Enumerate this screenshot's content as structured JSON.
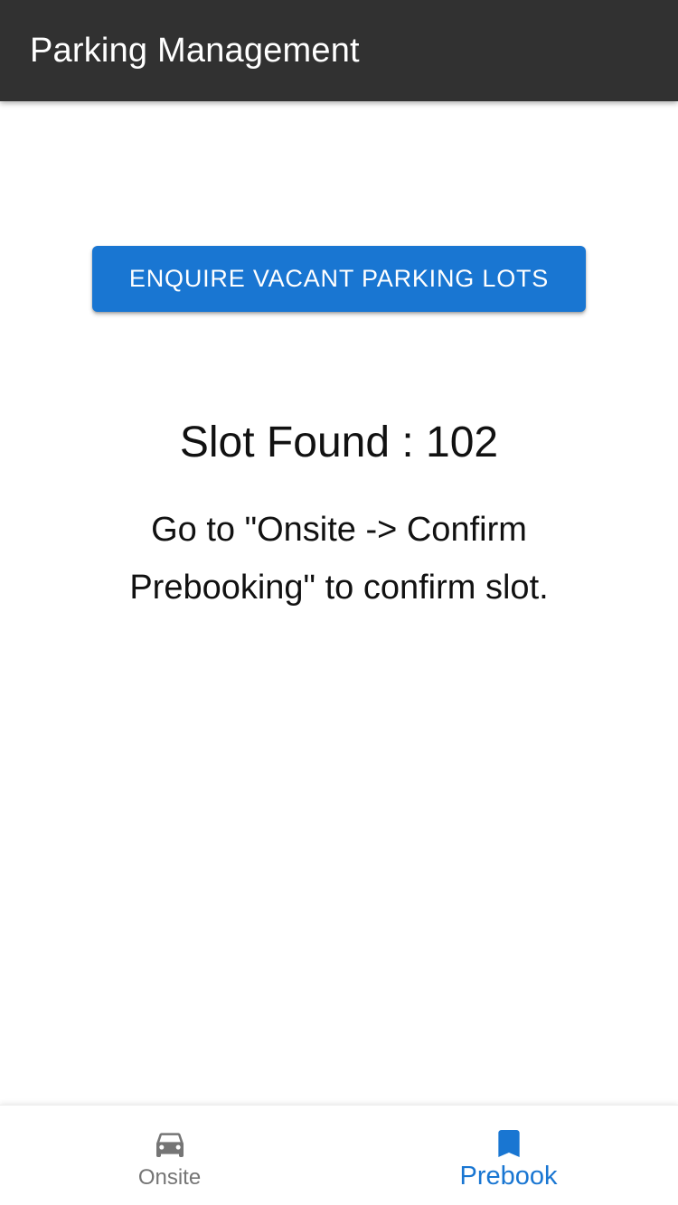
{
  "header": {
    "title": "Parking Management"
  },
  "main": {
    "enquire_button_label": "Enquire vacant parking lots",
    "slot_found_text": "Slot Found : 102",
    "instruction_text": "Go to \"Onsite -> Confirm Prebooking\" to confirm slot."
  },
  "bottom_nav": {
    "items": [
      {
        "label": "Onsite",
        "icon": "car-icon",
        "active": false
      },
      {
        "label": "Prebook",
        "icon": "bookmark-icon",
        "active": true
      }
    ]
  },
  "colors": {
    "app_bar": "#313131",
    "primary": "#1976d2",
    "inactive": "#757575"
  }
}
